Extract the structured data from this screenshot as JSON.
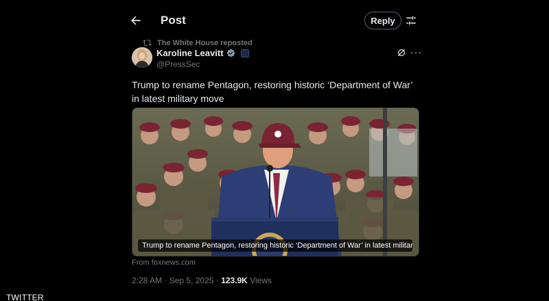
{
  "header": {
    "title": "Post",
    "reply_label": "Reply"
  },
  "repost": {
    "text": "The White House reposted"
  },
  "author": {
    "name": "Karoline Leavitt",
    "handle": "@PressSec"
  },
  "tweet": {
    "text": "Trump to rename Pentagon, restoring historic ‘Department of War’ in latest military move"
  },
  "link_card": {
    "caption": "Trump to rename Pentagon, restoring historic ‘Department of War’ in latest military mo...",
    "source": "From foxnews.com"
  },
  "meta": {
    "time": "2:28 AM",
    "separator": "·",
    "date": "Sep 5, 2025",
    "views_count": "123.9K",
    "views_label": "Views"
  },
  "watermark": "TWITTER",
  "icons": {
    "back": "arrow-left-icon",
    "tune": "sliders-icon",
    "repost": "repost-icon",
    "verified": "verified-badge-icon",
    "grok": "grok-icon",
    "more": "more-dots-icon"
  },
  "colors": {
    "background": "#000000",
    "text": "#e7e9ea",
    "muted": "#71767b",
    "verified": "#829aab",
    "border": "#536471"
  }
}
